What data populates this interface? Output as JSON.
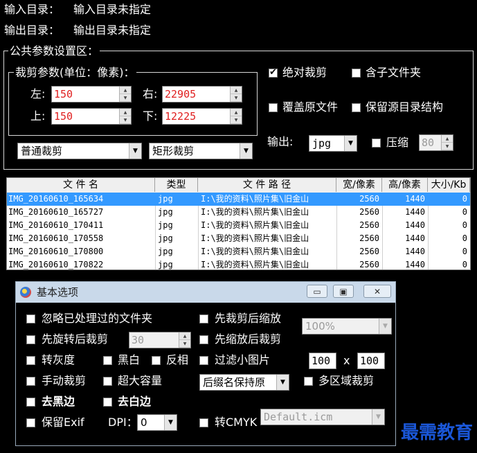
{
  "header": {
    "input_dir_label": "输入目录：",
    "input_dir_value": "输入目录未指定",
    "output_dir_label": "输出目录：",
    "output_dir_value": "输出目录未指定"
  },
  "public_params": {
    "legend": "公共参数设置区：",
    "crop": {
      "legend": "裁剪参数(单位：像素)：",
      "left_label": "左:",
      "left_value": "150",
      "right_label": "右:",
      "right_value": "22905",
      "top_label": "上:",
      "top_value": "150",
      "bottom_label": "下:",
      "bottom_value": "12225"
    },
    "crop_mode": "普通裁剪",
    "crop_shape": "矩形裁剪",
    "absolute_crop_label": "绝对裁剪",
    "absolute_crop_checked": true,
    "include_subfolders_label": "含子文件夹",
    "include_subfolders_checked": false,
    "overwrite_label": "覆盖原文件",
    "overwrite_checked": false,
    "keep_structure_label": "保留源目录结构",
    "keep_structure_checked": false,
    "output_label": "输出:",
    "output_format": "jpg",
    "compress_label": "压缩",
    "compress_checked": false,
    "compress_value": "80"
  },
  "table": {
    "columns": [
      "文 件 名",
      "类型",
      "文 件 路 径",
      "宽/像素",
      "高/像素",
      "大小/Kb"
    ],
    "rows": [
      {
        "name": "IMG_20160610_165634",
        "type": "jpg",
        "path": "I:\\我的资料\\照片集\\旧金山",
        "width": "2560",
        "height": "1440",
        "size": "0",
        "selected": true
      },
      {
        "name": "IMG_20160610_165727",
        "type": "jpg",
        "path": "I:\\我的资料\\照片集\\旧金山",
        "width": "2560",
        "height": "1440",
        "size": "0",
        "selected": false
      },
      {
        "name": "IMG_20160610_170411",
        "type": "jpg",
        "path": "I:\\我的资料\\照片集\\旧金山",
        "width": "2560",
        "height": "1440",
        "size": "0",
        "selected": false
      },
      {
        "name": "IMG_20160610_170558",
        "type": "jpg",
        "path": "I:\\我的资料\\照片集\\旧金山",
        "width": "2560",
        "height": "1440",
        "size": "0",
        "selected": false
      },
      {
        "name": "IMG_20160610_170800",
        "type": "jpg",
        "path": "I:\\我的资料\\照片集\\旧金山",
        "width": "2560",
        "height": "1440",
        "size": "0",
        "selected": false
      },
      {
        "name": "IMG_20160610_170822",
        "type": "jpg",
        "path": "I:\\我的资料\\照片集\\旧金山",
        "width": "2560",
        "height": "1440",
        "size": "0",
        "selected": false
      }
    ]
  },
  "dialog": {
    "title": "基本选项",
    "minimize_symbol": "▭",
    "maximize_symbol": "▣",
    "close_symbol": "✕",
    "ignore_processed_label": "忽略已处理过的文件夹",
    "crop_then_scale_label": "先裁剪后缩放",
    "scale_value": "100%",
    "rotate_then_crop_label": "先旋转后裁剪",
    "rotate_value": "30",
    "scale_then_crop_label": "先缩放后裁剪",
    "grayscale_label": "转灰度",
    "bw_label": "黑白",
    "invert_label": "反相",
    "filter_small_label": "过滤小图片",
    "filter_w": "100",
    "filter_x": "x",
    "filter_h": "100",
    "manual_crop_label": "手动裁剪",
    "large_capacity_label": "超大容量",
    "suffix_value": "后缀名保持原",
    "multi_region_label": "多区域裁剪",
    "remove_black_label": "去黑边",
    "remove_white_label": "去白边",
    "keep_exif_label": "保留Exif",
    "dpi_label": "DPI：",
    "dpi_value": "0",
    "cmyk_label": "转CMYK",
    "icm_value": "Default.icm"
  },
  "watermark": "最需教育"
}
